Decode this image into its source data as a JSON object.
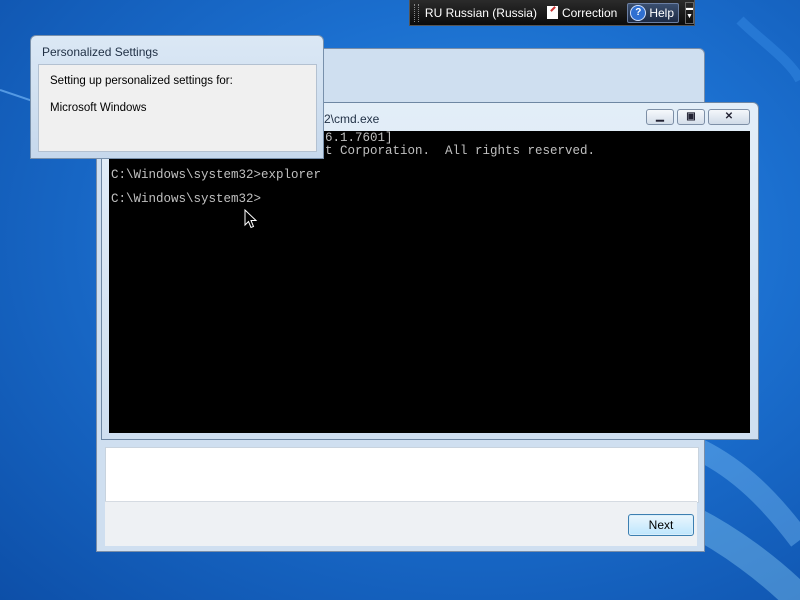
{
  "language_bar": {
    "language": "RU Russian (Russia)",
    "correction_label": "Correction",
    "help_label": "Help"
  },
  "personalized_dialog": {
    "title": "Personalized Settings",
    "line1": "Setting up personalized settings for:",
    "line2": "Microsoft Windows"
  },
  "cmd_window": {
    "title_visible": "2\\cmd.exe",
    "console_lines": [
      "6.1.7601]",
      "t Corporation.  All rights reserved.",
      "",
      "C:\\Windows\\system32>explorer",
      "",
      "C:\\Windows\\system32>"
    ]
  },
  "setup_window": {
    "next_label": "Next"
  },
  "colors": {
    "desktop": "#1b6fcf",
    "console_bg": "#000000",
    "console_text": "#c0c0c0"
  }
}
